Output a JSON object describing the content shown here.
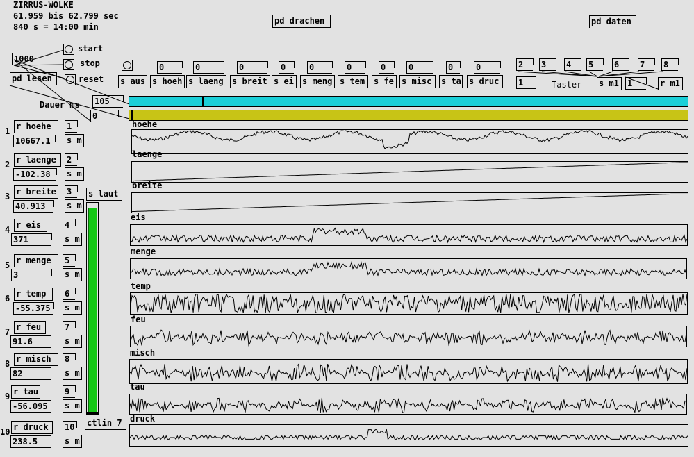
{
  "header": {
    "title": "ZIRRUS-WOLKE",
    "range": "61.959 bis 62.799 sec",
    "duration": "840 s = 14:00 min"
  },
  "top_objects": {
    "drachen": "pd drachen",
    "daten": "pd daten"
  },
  "transport": {
    "number_1000": "1000",
    "start": "start",
    "stop": "stop",
    "reset": "reset",
    "pd_lesen": "pd lesen",
    "dauer_label": "Dauer ms",
    "dauer_value": "105",
    "zero_value": "0"
  },
  "send_row": [
    {
      "num": "",
      "label": "s aus"
    },
    {
      "num": "0",
      "label": "s hoeh"
    },
    {
      "num": "0",
      "label": "s laeng"
    },
    {
      "num": "0",
      "label": "s breit"
    },
    {
      "num": "0",
      "label": "s ei"
    },
    {
      "num": "0",
      "label": "s meng"
    },
    {
      "num": "0",
      "label": "s tem"
    },
    {
      "num": "0",
      "label": "s fe"
    },
    {
      "num": "0",
      "label": "s misc"
    },
    {
      "num": "0",
      "label": "s ta"
    },
    {
      "num": "0",
      "label": "s druc"
    }
  ],
  "taster": {
    "numbers": [
      "2",
      "3",
      "4",
      "5",
      "6",
      "7",
      "8"
    ],
    "one_a": "1",
    "label": "Taster",
    "sm1": "s m1",
    "one_b": "1",
    "rm1": "r m1"
  },
  "progress": {
    "cyan_fraction": 0.13,
    "yellow_fraction": 0.003,
    "cyan_color": "#1ccfd8",
    "yellow_color": "#c8c416"
  },
  "channels": [
    {
      "index": "1",
      "receive": "r hoehe",
      "value": "10667.1",
      "ch": "1",
      "send": "s m"
    },
    {
      "index": "2",
      "receive": "r laenge",
      "value": "-102.38",
      "ch": "2",
      "send": "s m"
    },
    {
      "index": "3",
      "receive": "r breite",
      "value": "40.913",
      "ch": "3",
      "send": "s m"
    },
    {
      "index": "4",
      "receive": "r eis",
      "value": "371",
      "ch": "4",
      "send": "s m"
    },
    {
      "index": "5",
      "receive": "r menge",
      "value": "3",
      "ch": "5",
      "send": "s m"
    },
    {
      "index": "6",
      "receive": "r temp",
      "value": "-55.375",
      "ch": "6",
      "send": "s m"
    },
    {
      "index": "7",
      "receive": "r feu",
      "value": "91.6",
      "ch": "7",
      "send": "s m"
    },
    {
      "index": "8",
      "receive": "r misch",
      "value": "82",
      "ch": "8",
      "send": "s m"
    },
    {
      "index": "9",
      "receive": "r tau",
      "value": "-56.095",
      "ch": "9",
      "send": "s m"
    },
    {
      "index": "10",
      "receive": "r druck",
      "value": "238.5",
      "ch": "10",
      "send": "s m"
    }
  ],
  "slider": {
    "send_label": "s laut",
    "ctl_label": "ctlin 7",
    "level": 0.98,
    "color": "#14c814"
  },
  "arrays": [
    {
      "name": "hoehe"
    },
    {
      "name": "laenge"
    },
    {
      "name": "breite"
    },
    {
      "name": "eis"
    },
    {
      "name": "menge"
    },
    {
      "name": "temp"
    },
    {
      "name": "feu"
    },
    {
      "name": "misch"
    },
    {
      "name": "tau"
    },
    {
      "name": "druck"
    }
  ]
}
